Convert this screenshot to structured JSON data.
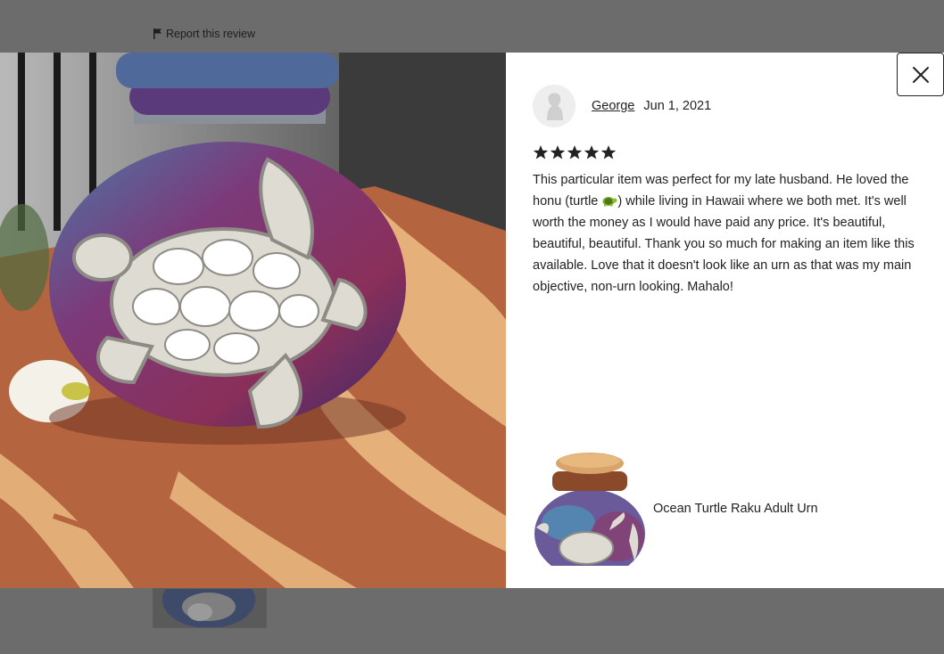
{
  "background": {
    "report_label": "Report this review"
  },
  "review": {
    "reviewer": "George",
    "date": "Jun 1, 2021",
    "rating": 5,
    "text_before_emoji": "This particular item was perfect for my late husband. He loved the honu (turtle ",
    "text_after_emoji": ") while living in Hawaii where we both met. It's well worth the money as I would have paid any price. It's beautiful, beautiful, beautiful. Thank you so much for making an item like this available. Love that it doesn't look like an urn as that was my main objective, non-urn looking. Mahalo!"
  },
  "product": {
    "name": "Ocean Turtle Raku Adult Urn"
  },
  "icons": {
    "close": "close-icon",
    "flag": "flag-icon",
    "star": "star-icon",
    "turtle": "turtle-emoji-icon"
  },
  "colors": {
    "star": "#222222",
    "overlay": "#6c6c6c"
  }
}
